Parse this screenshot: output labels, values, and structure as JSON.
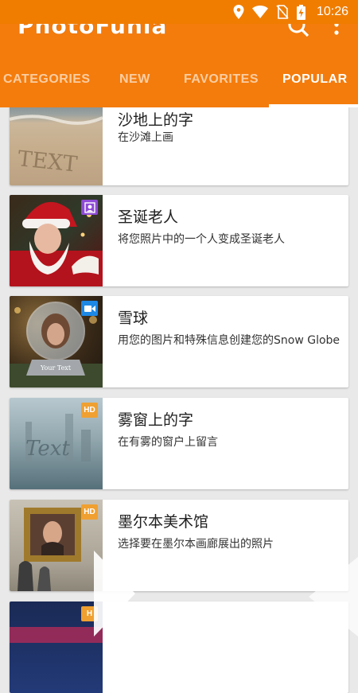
{
  "status_bar": {
    "time": "10:26",
    "icons": [
      "location-icon",
      "wifi-icon",
      "no-sim-icon",
      "battery-charging-icon"
    ]
  },
  "app": {
    "name": "PhotoFunia",
    "actions": [
      "search-icon",
      "more-vert-icon"
    ]
  },
  "tabs": [
    {
      "label": "CATEGORIES",
      "active": false
    },
    {
      "label": "NEW",
      "active": false
    },
    {
      "label": "FAVORITES",
      "active": false
    },
    {
      "label": "POPULAR",
      "active": true
    }
  ],
  "items": [
    {
      "title": "沙地上的字",
      "description": "在沙滩上画",
      "badge": ""
    },
    {
      "title": "圣诞老人",
      "description": "将您照片中的一个人变成圣诞老人",
      "badge": "face"
    },
    {
      "title": "雪球",
      "description": "用您的图片和特殊信息创建您的Snow Globe",
      "badge": "video"
    },
    {
      "title": "雾窗上的字",
      "description": "在有雾的窗户上留言",
      "badge": "HD"
    },
    {
      "title": "墨尔本美术馆",
      "description": "选择要在墨尔本画廊展出的照片",
      "badge": "HD"
    },
    {
      "title": "",
      "description": "",
      "badge": "H"
    }
  ],
  "thumb_text": {
    "sand": "TEXT",
    "globe": "Your Text",
    "fog": "Text"
  },
  "colors": {
    "accent": "#f47c0c",
    "badge_hd": "#f0a030",
    "badge_video": "#1e88e5",
    "badge_face": "#8e4bd6"
  }
}
